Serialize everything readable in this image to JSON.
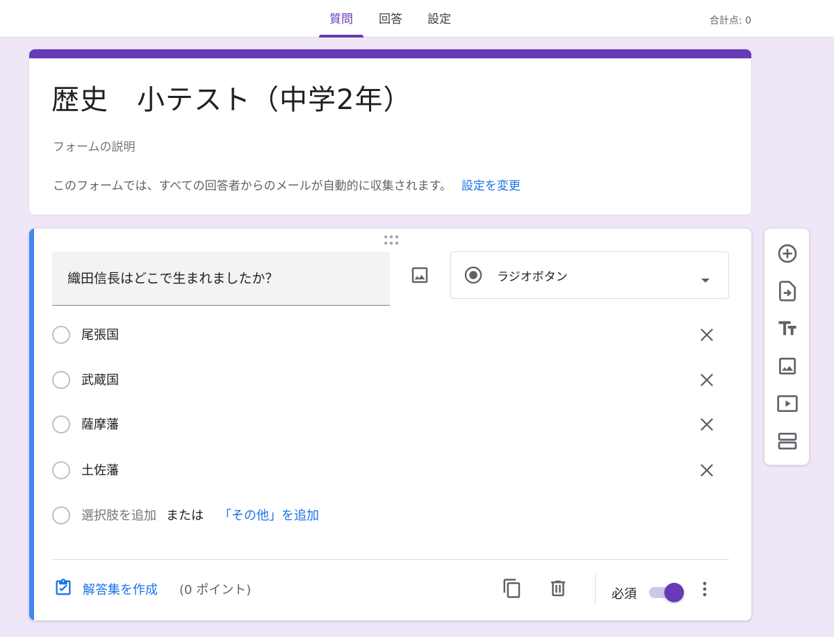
{
  "topbar": {
    "tabs": [
      {
        "label": "質問",
        "active": true
      },
      {
        "label": "回答",
        "active": false
      },
      {
        "label": "設定",
        "active": false
      }
    ],
    "total_points": "合計点: 0"
  },
  "header": {
    "title": "歴史　小テスト（中学2年）",
    "description_placeholder": "フォームの説明",
    "email_notice": "このフォームでは、すべての回答者からのメールが自動的に収集されます。",
    "change_settings_link": "設定を変更"
  },
  "question": {
    "title": "織田信長はどこで生まれましたか？",
    "type_label": "ラジオボタン",
    "options": [
      {
        "label": "尾張国"
      },
      {
        "label": "武蔵国"
      },
      {
        "label": "薩摩藩"
      },
      {
        "label": "土佐藩"
      }
    ],
    "add_option": "選択肢を追加",
    "or_text": "または",
    "add_other": "「その他」を追加",
    "answer_key_label": "解答集を作成",
    "points_label": "(0 ポイント)",
    "required_label": "必須",
    "required_on": true
  },
  "side_toolbar": {
    "icons": [
      "add-question-icon",
      "import-questions-icon",
      "add-title-icon",
      "add-image-icon",
      "add-video-icon",
      "add-section-icon"
    ]
  },
  "colors": {
    "accent": "#673ab7",
    "question_accent": "#4285f4",
    "link": "#1a73e8",
    "background": "#efe7f7"
  }
}
